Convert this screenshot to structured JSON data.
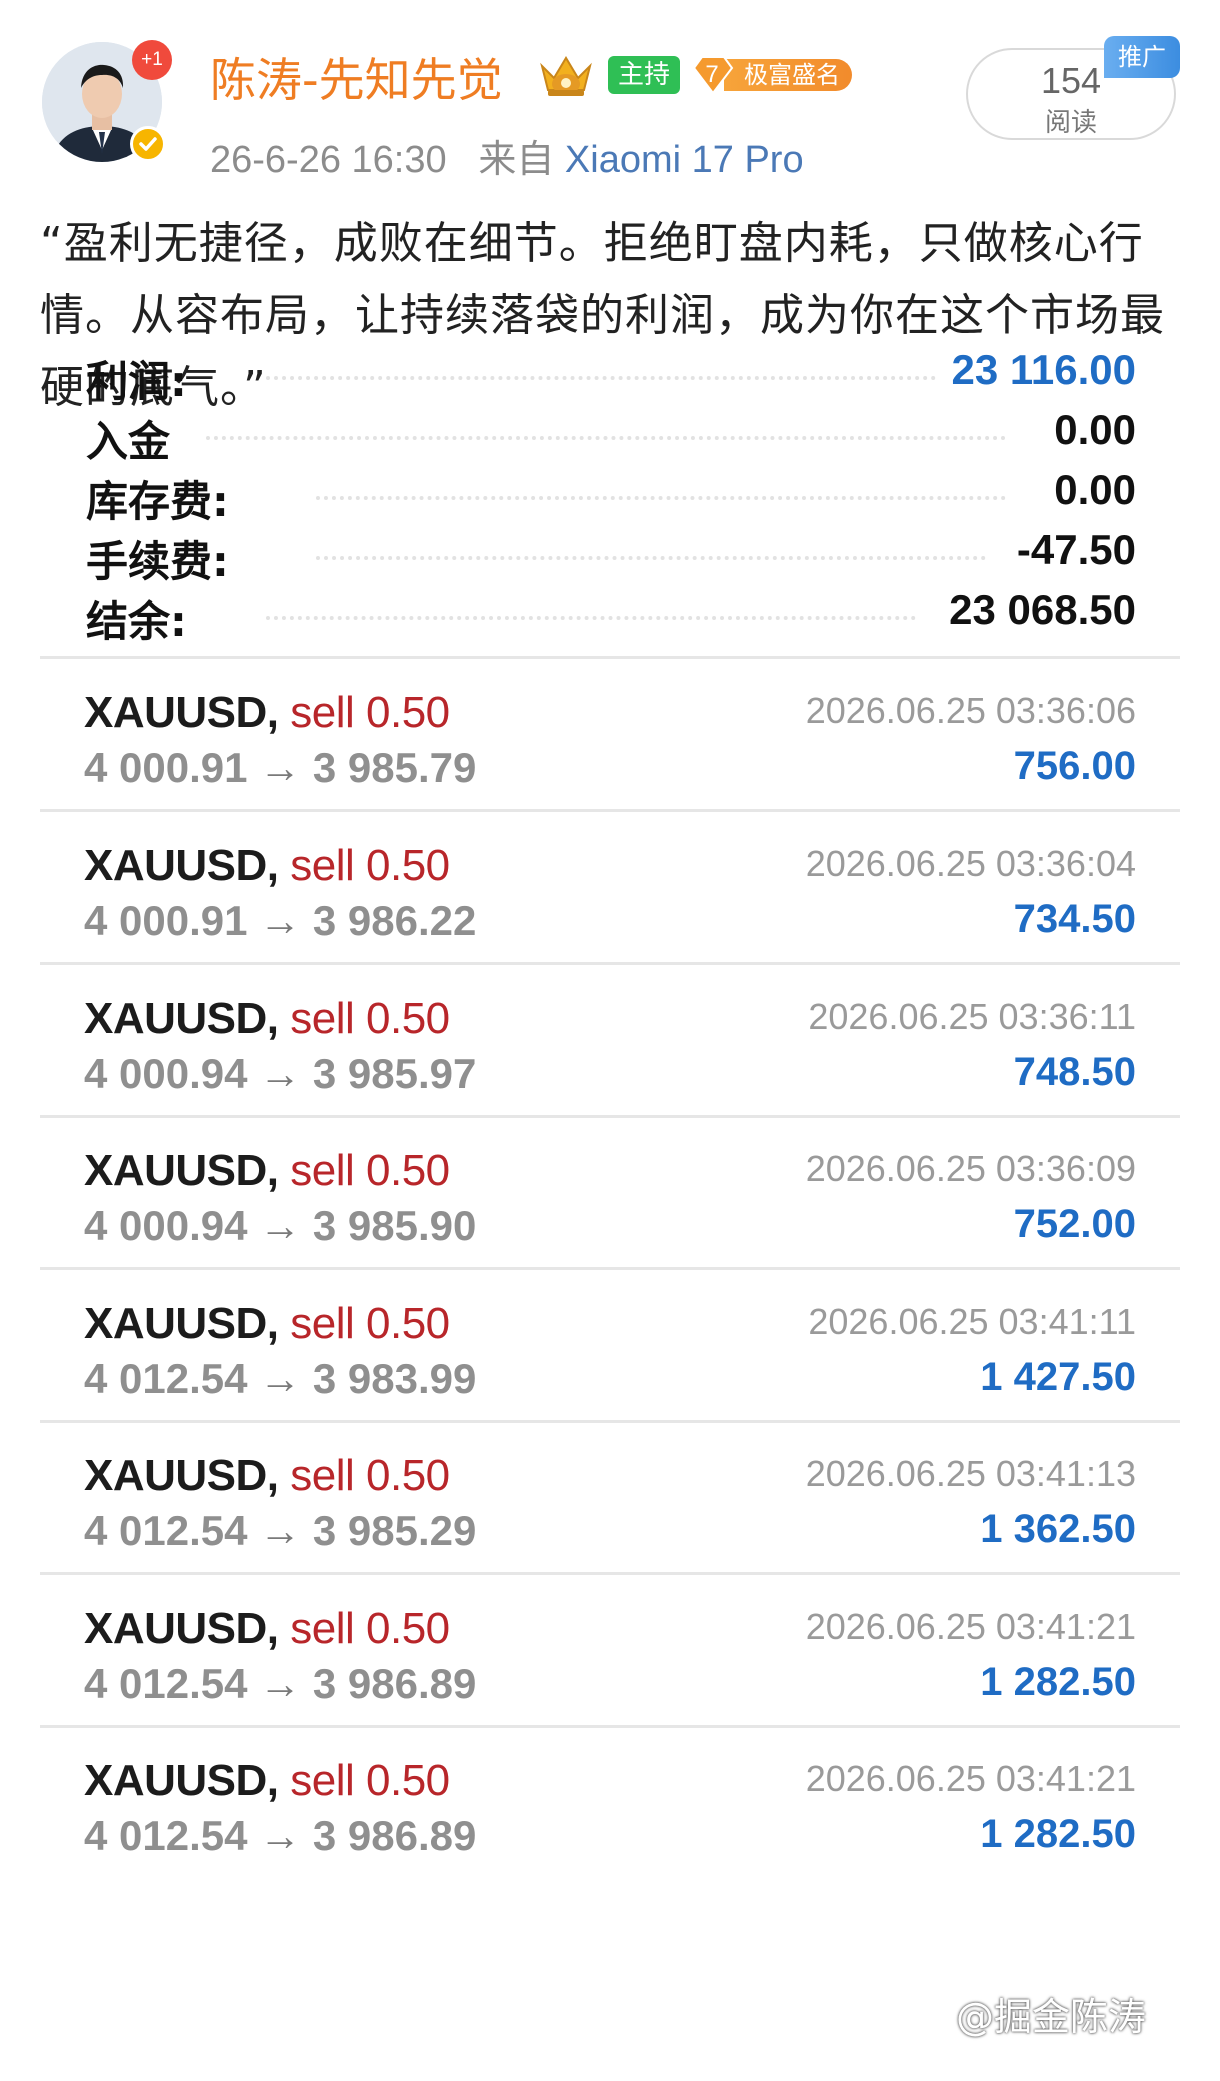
{
  "header": {
    "badge": "+1",
    "username": "陈涛-先知先觉",
    "tag_host": "主持",
    "tag_rich_level": "7",
    "tag_rich_label": "极富盛名",
    "date": "26-6-26 16:30",
    "source_prefix": "来自",
    "device": "Xiaomi 17 Pro",
    "reads_count": "154",
    "reads_label": "阅读",
    "promo": "推广"
  },
  "post": {
    "quote": "“盈利无捷径，成败在细节。拒绝盯盘内耗，只做核心行情。从容布局，让持续落袋的利润，成为你在这个市场最硬的底气。”"
  },
  "summary": [
    {
      "label": "利润:",
      "value": "23 116.00",
      "color": "#1f6cc4"
    },
    {
      "label": "入金",
      "value": "0.00",
      "color": "#111111"
    },
    {
      "label": "库存费:",
      "value": "0.00",
      "color": "#111111"
    },
    {
      "label": "手续费:",
      "value": "-47.50",
      "color": "#111111"
    },
    {
      "label": "结余:",
      "value": "23 068.50",
      "color": "#111111"
    }
  ],
  "trades": [
    {
      "symbol": "XAUUSD,",
      "side": "sell 0.50",
      "open": "4 000.91",
      "close": "3 985.79",
      "time": "2026.06.25 03:36:06",
      "profit": "756.00"
    },
    {
      "symbol": "XAUUSD,",
      "side": "sell 0.50",
      "open": "4 000.91",
      "close": "3 986.22",
      "time": "2026.06.25 03:36:04",
      "profit": "734.50"
    },
    {
      "symbol": "XAUUSD,",
      "side": "sell 0.50",
      "open": "4 000.94",
      "close": "3 985.97",
      "time": "2026.06.25 03:36:11",
      "profit": "748.50"
    },
    {
      "symbol": "XAUUSD,",
      "side": "sell 0.50",
      "open": "4 000.94",
      "close": "3 985.90",
      "time": "2026.06.25 03:36:09",
      "profit": "752.00"
    },
    {
      "symbol": "XAUUSD,",
      "side": "sell 0.50",
      "open": "4 012.54",
      "close": "3 983.99",
      "time": "2026.06.25 03:41:11",
      "profit": "1 427.50"
    },
    {
      "symbol": "XAUUSD,",
      "side": "sell 0.50",
      "open": "4 012.54",
      "close": "3 985.29",
      "time": "2026.06.25 03:41:13",
      "profit": "1 362.50"
    },
    {
      "symbol": "XAUUSD,",
      "side": "sell 0.50",
      "open": "4 012.54",
      "close": "3 986.89",
      "time": "2026.06.25 03:41:21",
      "profit": "1 282.50"
    },
    {
      "symbol": "XAUUSD,",
      "side": "sell 0.50",
      "open": "4 012.54",
      "close": "3 986.89",
      "time": "2026.06.25 03:41:21",
      "profit": "1 282.50"
    }
  ],
  "arrow": "→",
  "watermark": "@掘金陈涛",
  "colors": {
    "accent_orange": "#ef7d23",
    "profit_blue": "#1f6cc4",
    "sell_red": "#b8262a",
    "host_green": "#2fbf55"
  },
  "icons": {
    "avatar": "avatar-portrait",
    "crown": "crown-icon",
    "verified": "verified-icon",
    "rich": "diamond-icon"
  }
}
